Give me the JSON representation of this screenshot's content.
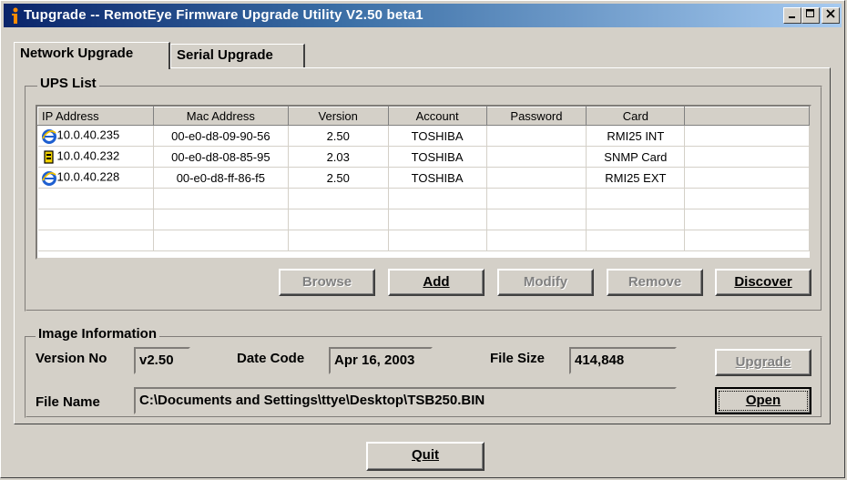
{
  "window": {
    "title": "Tupgrade -- RemotEye Firmware Upgrade Utility V2.50 beta1"
  },
  "tabs": [
    "Network Upgrade",
    "Serial Upgrade"
  ],
  "ups_list": {
    "label": "UPS List",
    "columns": [
      "IP Address",
      "Mac Address",
      "Version",
      "Account",
      "Password",
      "Card"
    ],
    "rows": [
      {
        "icon": "ie-globe-icon",
        "ip": "10.0.40.235",
        "mac": "00-e0-d8-09-90-56",
        "version": "2.50",
        "account": "TOSHIBA",
        "password": "",
        "card": "RMI25 INT"
      },
      {
        "icon": "snmp-card-icon",
        "ip": "10.0.40.232",
        "mac": "00-e0-d8-08-85-95",
        "version": "2.03",
        "account": "TOSHIBA",
        "password": "",
        "card": "SNMP Card"
      },
      {
        "icon": "ie-globe-icon",
        "ip": "10.0.40.228",
        "mac": "00-e0-d8-ff-86-f5",
        "version": "2.50",
        "account": "TOSHIBA",
        "password": "",
        "card": "RMI25 EXT"
      }
    ],
    "buttons": {
      "browse": "Browse",
      "add": "Add",
      "modify": "Modify",
      "remove": "Remove",
      "discover": "Discover"
    }
  },
  "image_info": {
    "label": "Image Information",
    "version_label": "Version No",
    "version_value": "v2.50",
    "date_label": "Date Code",
    "date_value": "Apr 16, 2003",
    "size_label": "File Size",
    "size_value": "414,848",
    "file_label": "File Name",
    "file_value": "C:\\Documents and Settings\\ttye\\Desktop\\TSB250.BIN",
    "upgrade_button": "Upgrade",
    "open_button": "Open"
  },
  "quit_button": "Quit",
  "colors": {
    "title_start": "#0a246a",
    "title_end": "#a6caf0",
    "face": "#d4d0c8",
    "disabled_text": "#808080"
  }
}
